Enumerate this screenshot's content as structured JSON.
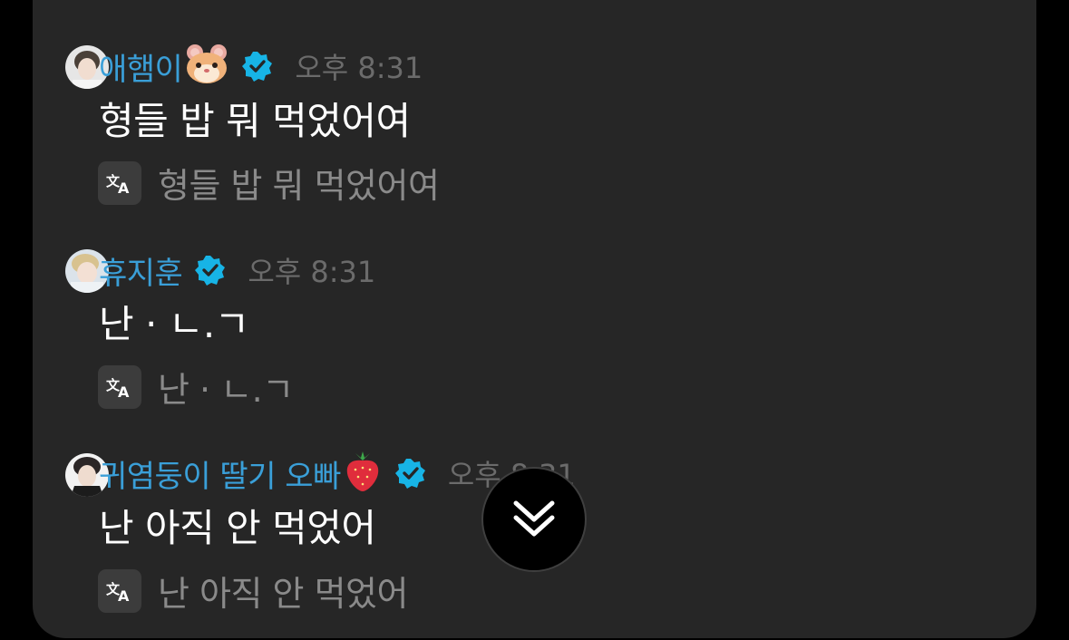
{
  "messages": [
    {
      "author": "애햄이",
      "author_emoji": "🐹",
      "verified_icon": "verified-badge-icon",
      "time": "오후 8:31",
      "text": "형들 밥 뭐 먹었어여",
      "translation": "형들 밥 뭐 먹었어여"
    },
    {
      "author": "휴지훈",
      "author_emoji": "",
      "verified_icon": "verified-badge-icon",
      "time": "오후 8:31",
      "text": "난 · ㄴ.ㄱ",
      "translation": "난 · ㄴ.ㄱ"
    },
    {
      "author": "귀염둥이 딸기 오빠",
      "author_emoji": "🍓",
      "verified_icon": "verified-badge-icon",
      "time": "오후 8:31",
      "text": "난 아직 안 먹었어",
      "translation": "난 아직 안 먹었어"
    }
  ],
  "icons": {
    "translate": "translate-icon",
    "scroll": "double-chevron-down-icon"
  },
  "colors": {
    "background": "#000000",
    "panel": "#262626",
    "author": "#3a9fd8",
    "verified": "#17b4e6",
    "time": "#6b6b6b",
    "message": "#ffffff",
    "translation": "#8a8a8a"
  }
}
